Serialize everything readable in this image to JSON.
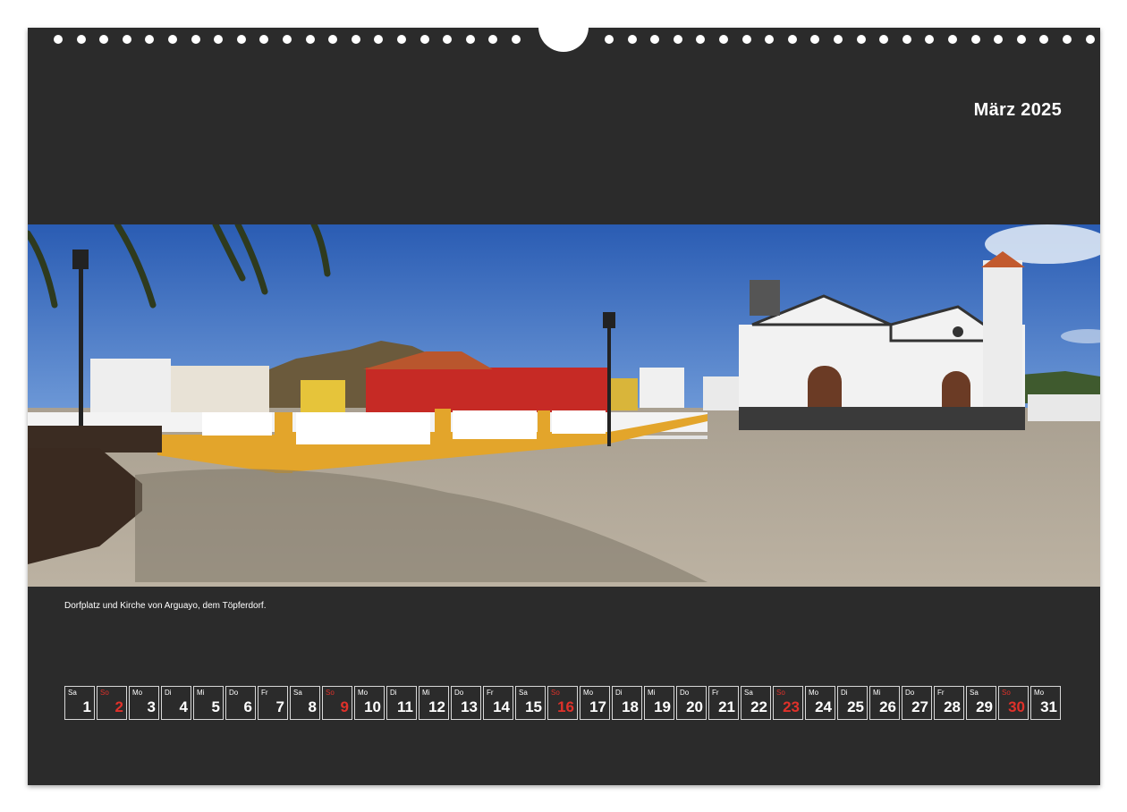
{
  "calendar_month": {
    "title": "März 2025"
  },
  "photo": {
    "caption": "Dorfplatz und Kirche von Arguayo, dem Töpferdorf.",
    "colors": {
      "sky": "#2e63b8",
      "plaza": "#b5aa98",
      "wall_orange": "#e3a52b",
      "red_house": "#c62a25",
      "church_white": "#f2f2f2"
    }
  },
  "colors": {
    "background": "#2b2b2b",
    "text": "#ffffff",
    "sunday": "#e0312a",
    "cell_border": "#d8d8d8"
  },
  "days": [
    {
      "wd": "Sa",
      "num": "1",
      "sunday": false
    },
    {
      "wd": "So",
      "num": "2",
      "sunday": true
    },
    {
      "wd": "Mo",
      "num": "3",
      "sunday": false
    },
    {
      "wd": "Di",
      "num": "4",
      "sunday": false
    },
    {
      "wd": "Mi",
      "num": "5",
      "sunday": false
    },
    {
      "wd": "Do",
      "num": "6",
      "sunday": false
    },
    {
      "wd": "Fr",
      "num": "7",
      "sunday": false
    },
    {
      "wd": "Sa",
      "num": "8",
      "sunday": false
    },
    {
      "wd": "So",
      "num": "9",
      "sunday": true
    },
    {
      "wd": "Mo",
      "num": "10",
      "sunday": false
    },
    {
      "wd": "Di",
      "num": "11",
      "sunday": false
    },
    {
      "wd": "Mi",
      "num": "12",
      "sunday": false
    },
    {
      "wd": "Do",
      "num": "13",
      "sunday": false
    },
    {
      "wd": "Fr",
      "num": "14",
      "sunday": false
    },
    {
      "wd": "Sa",
      "num": "15",
      "sunday": false
    },
    {
      "wd": "So",
      "num": "16",
      "sunday": true
    },
    {
      "wd": "Mo",
      "num": "17",
      "sunday": false
    },
    {
      "wd": "Di",
      "num": "18",
      "sunday": false
    },
    {
      "wd": "Mi",
      "num": "19",
      "sunday": false
    },
    {
      "wd": "Do",
      "num": "20",
      "sunday": false
    },
    {
      "wd": "Fr",
      "num": "21",
      "sunday": false
    },
    {
      "wd": "Sa",
      "num": "22",
      "sunday": false
    },
    {
      "wd": "So",
      "num": "23",
      "sunday": true
    },
    {
      "wd": "Mo",
      "num": "24",
      "sunday": false
    },
    {
      "wd": "Di",
      "num": "25",
      "sunday": false
    },
    {
      "wd": "Mi",
      "num": "26",
      "sunday": false
    },
    {
      "wd": "Do",
      "num": "27",
      "sunday": false
    },
    {
      "wd": "Fr",
      "num": "28",
      "sunday": false
    },
    {
      "wd": "Sa",
      "num": "29",
      "sunday": false
    },
    {
      "wd": "So",
      "num": "30",
      "sunday": true
    },
    {
      "wd": "Mo",
      "num": "31",
      "sunday": false
    }
  ]
}
